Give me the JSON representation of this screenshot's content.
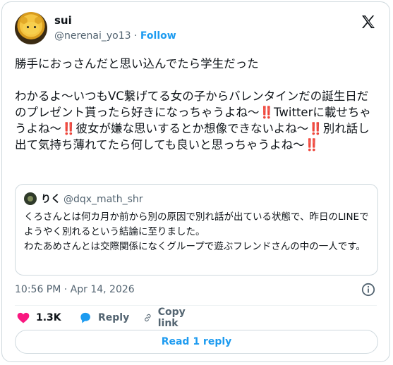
{
  "author": {
    "display_name": "sui",
    "handle": "@nerenai_yo13",
    "separator": "·",
    "follow_label": "Follow"
  },
  "tweet": {
    "line1": "勝手におっさんだと思い込んでたら学生だった",
    "p1": "わかるよ〜いつもVC繋げてる女の子からバレンタインだの誕生日だのプレゼント貰ったら好きになっちゃうよね〜",
    "p2": "Twitterに載せちゃうよね〜",
    "p3": "彼女が嫌な思いするとか想像できないよね〜",
    "p4": "別れ話し出て気持ち薄れてたら何しても良いと思っちゃうよね〜",
    "bang": "‼️"
  },
  "quote": {
    "name": "りく",
    "handle": "@dqx_math_shr",
    "text": "くろさんとは何カ月か前から別の原因で別れ話が出ている状態で、昨日のLINEでようやく別れるという結論に至りました。\nわたあめさんとは交際関係になくグループで遊ぶフレンドさんの中の一人です。"
  },
  "timestamp": "10:56 PM · Apr 14, 2026",
  "actions": {
    "like_count": "1.3K",
    "reply_label": "Reply",
    "copy_label": "Copy link"
  },
  "read_reply_label": "Read 1 reply",
  "colors": {
    "accent": "#1d9bf0",
    "like": "#f91880",
    "bang": "#d21b2a"
  },
  "icons": [
    "x-logo-icon",
    "info-icon",
    "heart-icon",
    "reply-bubble-icon",
    "link-icon"
  ]
}
